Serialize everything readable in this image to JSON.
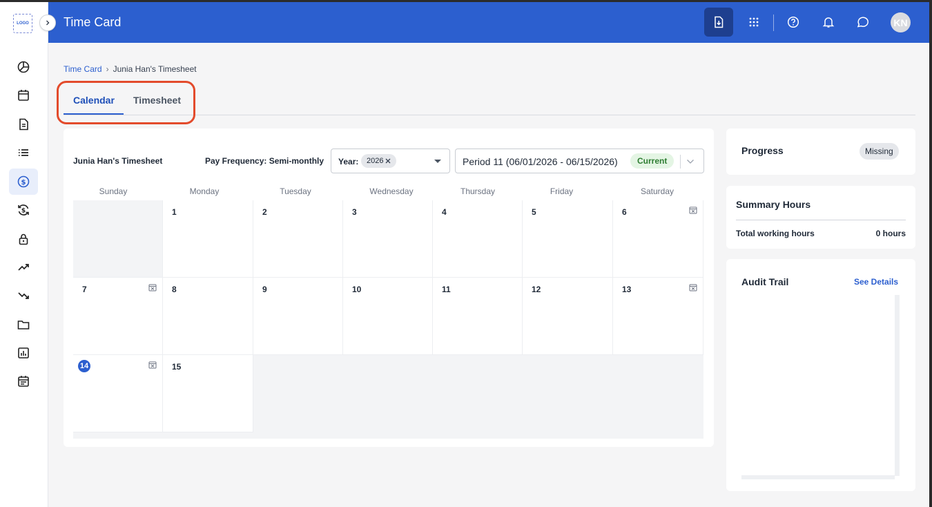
{
  "app": {
    "logo_text": "LOGO",
    "title": "Time Card",
    "avatar_initials": "KN"
  },
  "breadcrumb": {
    "root": "Time Card",
    "separator": "›",
    "current": "Junia Han's Timesheet"
  },
  "tabs": [
    {
      "label": "Calendar",
      "active": true
    },
    {
      "label": "Timesheet",
      "active": false
    }
  ],
  "calendar": {
    "title": "Junia Han's Timesheet",
    "pay_frequency": "Pay Frequency: Semi-monthly",
    "year_label": "Year:",
    "year_value": "2026",
    "period_value": "Period 11 (06/01/2026 - 06/15/2026)",
    "period_status": "Current",
    "weekdays": [
      "Sunday",
      "Monday",
      "Tuesday",
      "Wednesday",
      "Thursday",
      "Friday",
      "Saturday"
    ],
    "days": [
      "1",
      "2",
      "3",
      "4",
      "5",
      "6",
      "7",
      "8",
      "9",
      "10",
      "11",
      "12",
      "13",
      "14",
      "15"
    ],
    "today": "14"
  },
  "progress": {
    "title": "Progress",
    "status": "Missing"
  },
  "summary": {
    "title": "Summary Hours",
    "total_label": "Total working hours",
    "total_value": "0 hours"
  },
  "audit": {
    "title": "Audit Trail",
    "link": "See Details"
  },
  "colors": {
    "header": "#2c5fcf",
    "accent": "#2c5fcf",
    "highlight": "#e34b2c",
    "current_chip_bg": "#e4f5e4"
  }
}
